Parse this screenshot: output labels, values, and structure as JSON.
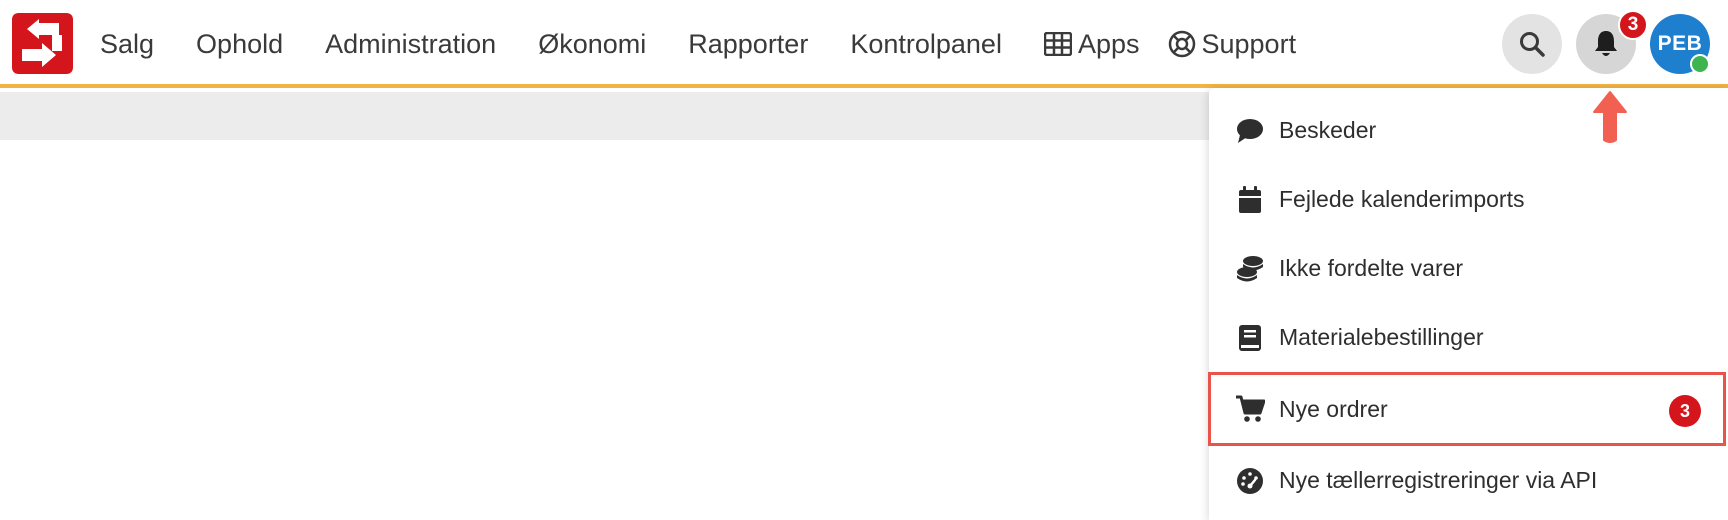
{
  "nav": {
    "items": [
      {
        "label": "Salg"
      },
      {
        "label": "Ophold"
      },
      {
        "label": "Administration"
      },
      {
        "label": "Økonomi"
      },
      {
        "label": "Rapporter"
      },
      {
        "label": "Kontrolpanel"
      }
    ],
    "apps_label": "Apps",
    "support_label": "Support"
  },
  "header": {
    "notification_count": "3",
    "avatar_initials": "PEB"
  },
  "dropdown": {
    "items": [
      {
        "label": "Beskeder",
        "icon": "comment-icon"
      },
      {
        "label": "Fejlede kalenderimports",
        "icon": "calendar-icon"
      },
      {
        "label": "Ikke fordelte varer",
        "icon": "coins-icon"
      },
      {
        "label": "Materialebestillinger",
        "icon": "book-icon"
      },
      {
        "label": "Nye ordrer",
        "icon": "cart-icon",
        "badge": "3"
      },
      {
        "label": "Nye tællerregistreringer via API",
        "icon": "gauge-icon"
      }
    ]
  },
  "colors": {
    "accent": "#f0b442",
    "badge": "#d4161c",
    "brand": "#d4161c",
    "avatar": "#1f7fcf",
    "highlight": "#e8534a"
  }
}
